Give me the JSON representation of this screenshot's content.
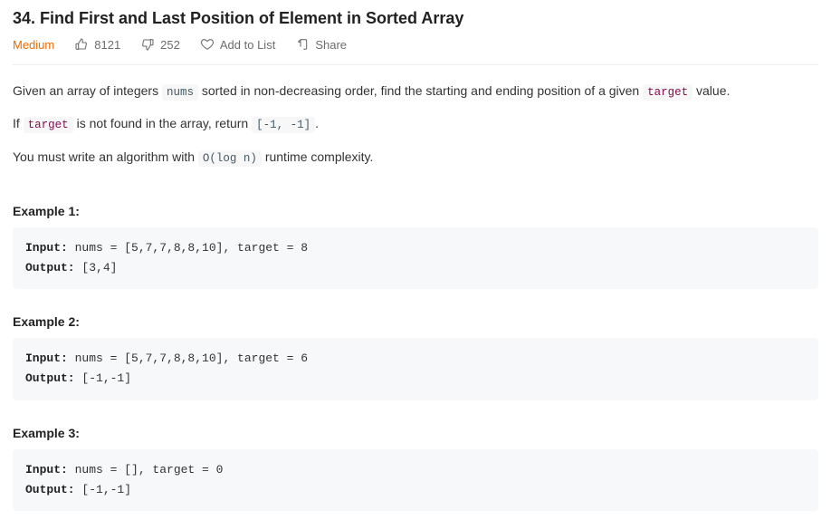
{
  "title": "34. Find First and Last Position of Element in Sorted Array",
  "difficulty": "Medium",
  "likes": "8121",
  "dislikes": "252",
  "addToList": "Add to List",
  "share": "Share",
  "desc": {
    "p1a": "Given an array of integers ",
    "p1_nums": "nums",
    "p1b": " sorted in non-decreasing order, find the starting and ending position of a given ",
    "p1_target": "target",
    "p1c": " value.",
    "p2a": "If ",
    "p2_target": "target",
    "p2b": " is not found in the array, return ",
    "p2_ret": "[-1, -1]",
    "p2c": ".",
    "p3a": "You must write an algorithm with ",
    "p3_o": "O(log n)",
    "p3b": " runtime complexity."
  },
  "examples": [
    {
      "heading": "Example 1:",
      "inputLabel": "Input:",
      "input": " nums = [5,7,7,8,8,10], target = 8",
      "outputLabel": "Output:",
      "output": " [3,4]"
    },
    {
      "heading": "Example 2:",
      "inputLabel": "Input:",
      "input": " nums = [5,7,7,8,8,10], target = 6",
      "outputLabel": "Output:",
      "output": " [-1,-1]"
    },
    {
      "heading": "Example 3:",
      "inputLabel": "Input:",
      "input": " nums = [], target = 0",
      "outputLabel": "Output:",
      "output": " [-1,-1]"
    }
  ]
}
